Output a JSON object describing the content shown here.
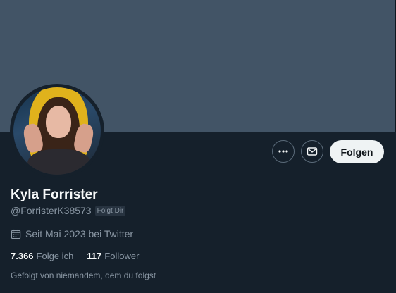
{
  "profile": {
    "display_name": "Kyla Forrister",
    "handle": "@ForristerK38573",
    "follows_you_badge": "Folgt Dir",
    "joined": "Seit Mai 2023 bei Twitter",
    "following_count": "7.366",
    "following_label": "Folge ich",
    "followers_count": "117",
    "followers_label": "Follower",
    "followed_by": "Gefolgt von niemandem, dem du folgst"
  },
  "actions": {
    "more_icon": "more-horizontal-icon",
    "message_icon": "envelope-icon",
    "follow_label": "Folgen"
  },
  "icons": {
    "calendar": "calendar-icon"
  },
  "colors": {
    "background": "#15202b",
    "banner": "#425466",
    "text_primary": "#f7f9f9",
    "text_secondary": "#8b98a5",
    "follow_button": "#eff3f4"
  }
}
